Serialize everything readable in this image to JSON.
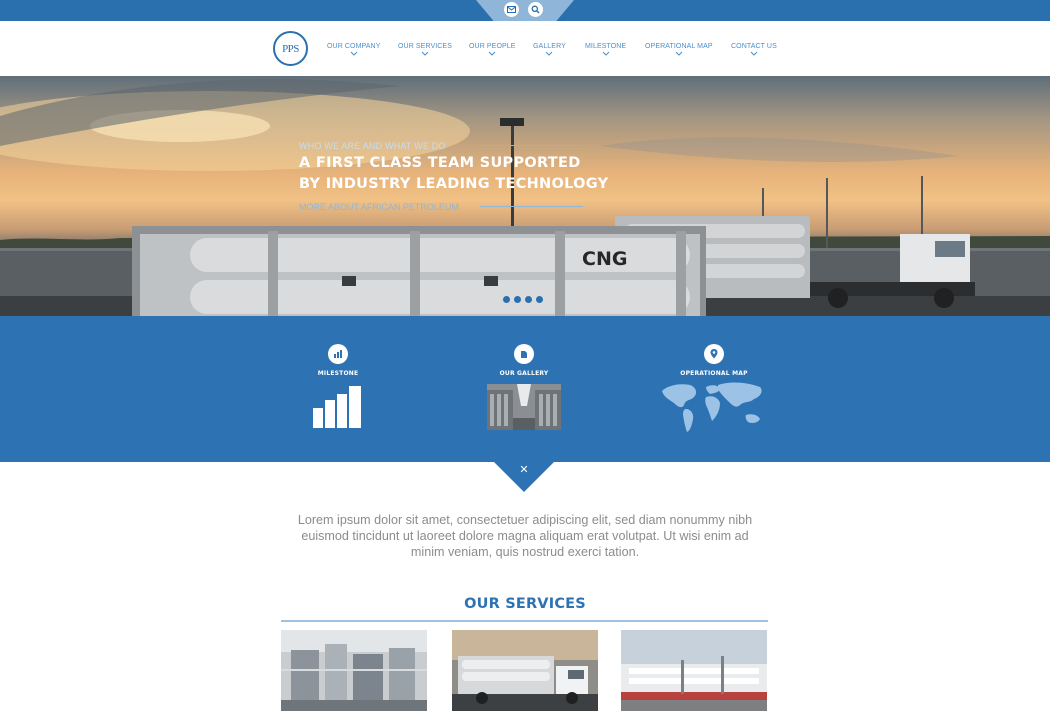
{
  "header": {
    "icons": [
      "mail-icon",
      "search-icon"
    ],
    "logo_text": "PPS",
    "nav": [
      {
        "label": "OUR COMPANY"
      },
      {
        "label": "OUR SERVICES"
      },
      {
        "label": "OUR PEOPLE"
      },
      {
        "label": "GALLERY"
      },
      {
        "label": "MILESTONE"
      },
      {
        "label": "OPERATIONAL MAP"
      },
      {
        "label": "CONTACT US"
      }
    ]
  },
  "hero": {
    "kicker": "WHO WE ARE AND WHAT WE DO",
    "headline_line1": "A FIRST CLASS TEAM SUPPORTED",
    "headline_line2": "BY INDUSTRY LEADING TECHNOLOGY",
    "link": "MORE ABOUT AFRICAN PETROLEUM",
    "truck_label": "CNG",
    "slides": 4
  },
  "features": [
    {
      "label": "MILESTONE",
      "icon": "bar-chart-icon"
    },
    {
      "label": "OUR GALLERY",
      "icon": "gallery-icon"
    },
    {
      "label": "OPERATIONAL MAP",
      "icon": "map-pin-icon"
    }
  ],
  "intro": {
    "text": "Lorem ipsum dolor sit amet, consectetuer adipiscing elit, sed diam nonummy nibh euismod tincidunt ut laoreet dolore magna aliquam erat volutpat. Ut wisi enim ad minim veniam, quis nostrud exerci tation."
  },
  "services": {
    "title": "OUR SERVICES"
  },
  "colors": {
    "brand_blue": "#2d73b3",
    "top_bar": "#2a6fae",
    "nav_text": "#4b8fcc",
    "body_text": "#8c8c8c"
  }
}
